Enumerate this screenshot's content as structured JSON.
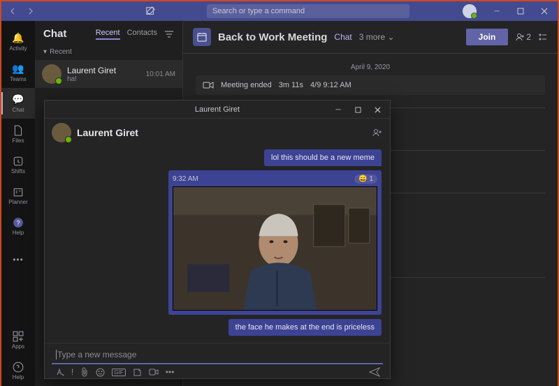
{
  "titlebar": {
    "search_placeholder": "Search or type a command",
    "minimize_icon": "minimize",
    "maximize_icon": "maximize",
    "close_icon": "close"
  },
  "leftrail": {
    "items": [
      {
        "label": "Activity",
        "icon": "bell"
      },
      {
        "label": "Teams",
        "icon": "people"
      },
      {
        "label": "Chat",
        "icon": "chat",
        "active": true
      },
      {
        "label": "Files",
        "icon": "file"
      },
      {
        "label": "Shifts",
        "icon": "clock"
      },
      {
        "label": "Planner",
        "icon": "planner"
      },
      {
        "label": "Help",
        "icon": "help"
      }
    ],
    "apps_label": "Apps",
    "help_label": "Help"
  },
  "chatlist": {
    "title": "Chat",
    "tabs": {
      "recent": "Recent",
      "contacts": "Contacts"
    },
    "section_recent": "Recent",
    "items": [
      {
        "name": "Laurent Giret",
        "preview": "ha!",
        "time": "10:01 AM"
      }
    ]
  },
  "conversation": {
    "title": "Back to Work Meeting",
    "tab_chat": "Chat",
    "more": "3 more",
    "join": "Join",
    "participants_count": "2",
    "date": "April 9, 2020",
    "call_ended_label": "Meeting ended",
    "call_duration": "3m 11s",
    "call_time": "4/9 9:12 AM"
  },
  "popout": {
    "title": "Laurent Giret",
    "header_name": "Laurent Giret",
    "msg_partial": "lol this should be a new meme",
    "msg_time": "9:32 AM",
    "reaction_count": "1",
    "msg_caption": "the face he makes at the end is priceless",
    "compose_placeholder": "Type a new message"
  }
}
